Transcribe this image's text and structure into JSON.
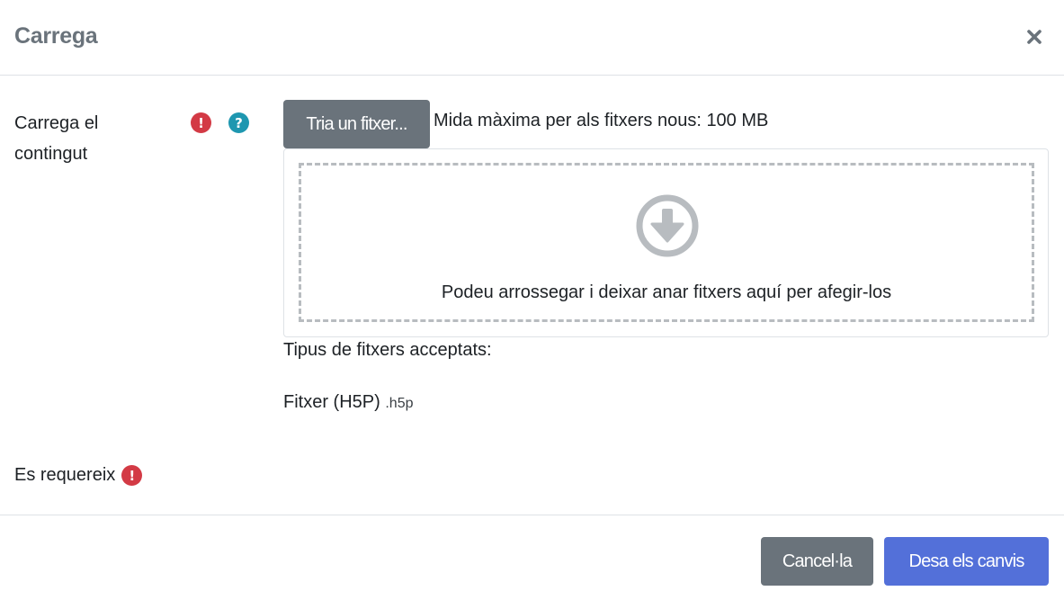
{
  "modal": {
    "title": "Carrega",
    "close_icon": "times-icon"
  },
  "field": {
    "label": "Carrega el contingut",
    "required_icon": "exclamation-circle-icon",
    "help_icon": "question-circle-icon",
    "choose_button": "Tria un fitxer...",
    "max_size_text": "Mida màxima per als fitxers nous: 100 MB",
    "dropzone_icon": "arrow-circle-down-icon",
    "dropzone_text": "Podeu arrossegar i deixar anar fitxers aquí per afegir-los",
    "accepted_title": "Tipus de fitxers acceptats:",
    "accepted_type_name": "Fitxer (H5P)",
    "accepted_type_ext": ".h5p"
  },
  "required_note": {
    "text": "Es requereix",
    "icon": "exclamation-circle-icon"
  },
  "footer": {
    "cancel_label": "Cancel·la",
    "save_label": "Desa els canvis"
  },
  "colors": {
    "title_gray": "#6a737b",
    "secondary_button": "#6a737b",
    "primary_button": "#5370d9",
    "required_red": "#d33a45",
    "help_teal": "#1e97b0",
    "dropzone_border": "#b8bcc0"
  }
}
